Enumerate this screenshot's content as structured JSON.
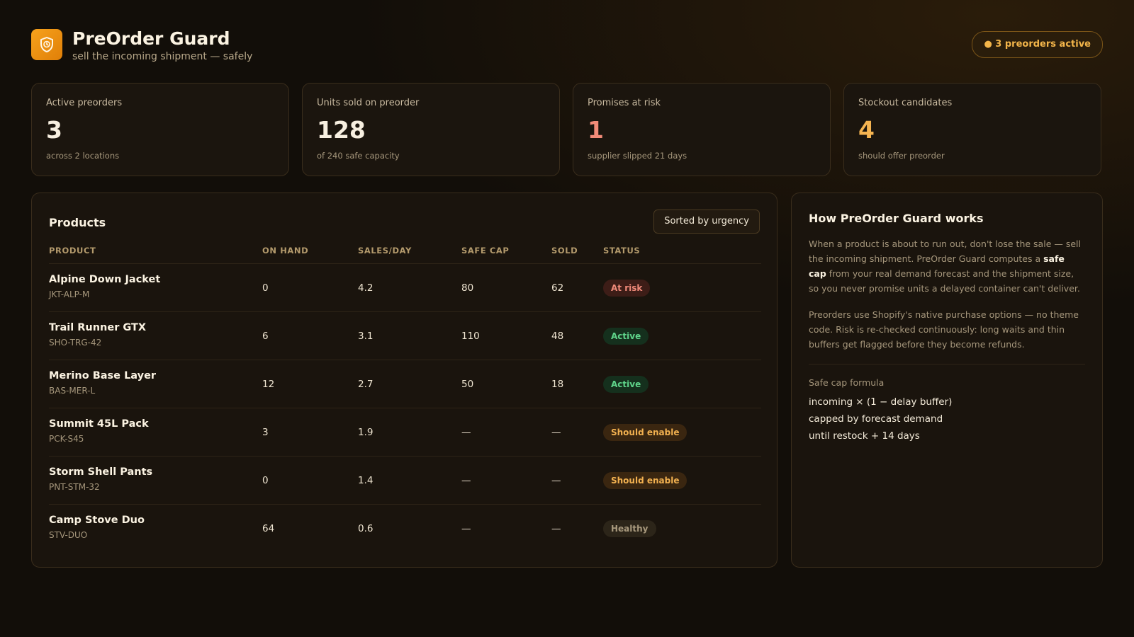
{
  "app": {
    "title": "PreOrder Guard",
    "subtitle": "sell the incoming shipment — safely",
    "active_badge": "● 3 preorders active",
    "icon": "shield-clock-icon",
    "accent": "#f39c12"
  },
  "stats": [
    {
      "label": "Active preorders",
      "value": "3",
      "note": "across 2 locations",
      "color": "#f7efe0"
    },
    {
      "label": "Units sold on preorder",
      "value": "128",
      "note": "of 240 safe capacity",
      "color": "#f7efe0"
    },
    {
      "label": "Promises at risk",
      "value": "1",
      "note": "supplier slipped 21 days",
      "color": "#f28b78"
    },
    {
      "label": "Stockout candidates",
      "value": "4",
      "note": "should offer preorder",
      "color": "#f5b451"
    }
  ],
  "products": {
    "title": "Products",
    "sort_label": "Sorted by urgency",
    "columns": [
      "PRODUCT",
      "ON HAND",
      "SALES/DAY",
      "SAFE CAP",
      "SOLD",
      "STATUS"
    ],
    "rows": [
      {
        "name": "Alpine Down Jacket",
        "sku": "JKT-ALP-M",
        "on_hand": "0",
        "sales_per_day": "4.2",
        "safe_cap": "80",
        "sold": "62",
        "status": "At risk",
        "status_kind": "risk"
      },
      {
        "name": "Trail Runner GTX",
        "sku": "SHO-TRG-42",
        "on_hand": "6",
        "sales_per_day": "3.1",
        "safe_cap": "110",
        "sold": "48",
        "status": "Active",
        "status_kind": "active"
      },
      {
        "name": "Merino Base Layer",
        "sku": "BAS-MER-L",
        "on_hand": "12",
        "sales_per_day": "2.7",
        "safe_cap": "50",
        "sold": "18",
        "status": "Active",
        "status_kind": "active"
      },
      {
        "name": "Summit 45L Pack",
        "sku": "PCK-S45",
        "on_hand": "3",
        "sales_per_day": "1.9",
        "safe_cap": "—",
        "sold": "—",
        "status": "Should enable",
        "status_kind": "enable"
      },
      {
        "name": "Storm Shell Pants",
        "sku": "PNT-STM-32",
        "on_hand": "0",
        "sales_per_day": "1.4",
        "safe_cap": "—",
        "sold": "—",
        "status": "Should enable",
        "status_kind": "enable"
      },
      {
        "name": "Camp Stove Duo",
        "sku": "STV-DUO",
        "on_hand": "64",
        "sales_per_day": "0.6",
        "safe_cap": "—",
        "sold": "—",
        "status": "Healthy",
        "status_kind": "healthy"
      }
    ],
    "status_colors": {
      "risk": {
        "bg": "#3d1d17",
        "fg": "#f08a7a"
      },
      "active": {
        "bg": "#15301d",
        "fg": "#5fd48a"
      },
      "enable": {
        "bg": "#3a2610",
        "fg": "#f2b150"
      },
      "healthy": {
        "bg": "#2c2519",
        "fg": "#a8997d"
      }
    }
  },
  "how": {
    "title": "How PreOrder Guard works",
    "p1_before": "When a product is about to run out, don't lose the sale — sell the incoming shipment. PreOrder Guard computes a ",
    "p1_strong": "safe cap",
    "p1_after": " from your real demand forecast and the shipment size, so you never promise units a delayed container can't deliver.",
    "p2": "Preorders use Shopify's native purchase options — no theme code. Risk is re-checked continuously: long waits and thin buffers get flagged before they become refunds.",
    "formula_label": "Safe cap formula",
    "formula_lines": [
      "incoming × (1 − delay buffer)",
      "capped by forecast demand",
      "until restock + 14 days"
    ]
  }
}
